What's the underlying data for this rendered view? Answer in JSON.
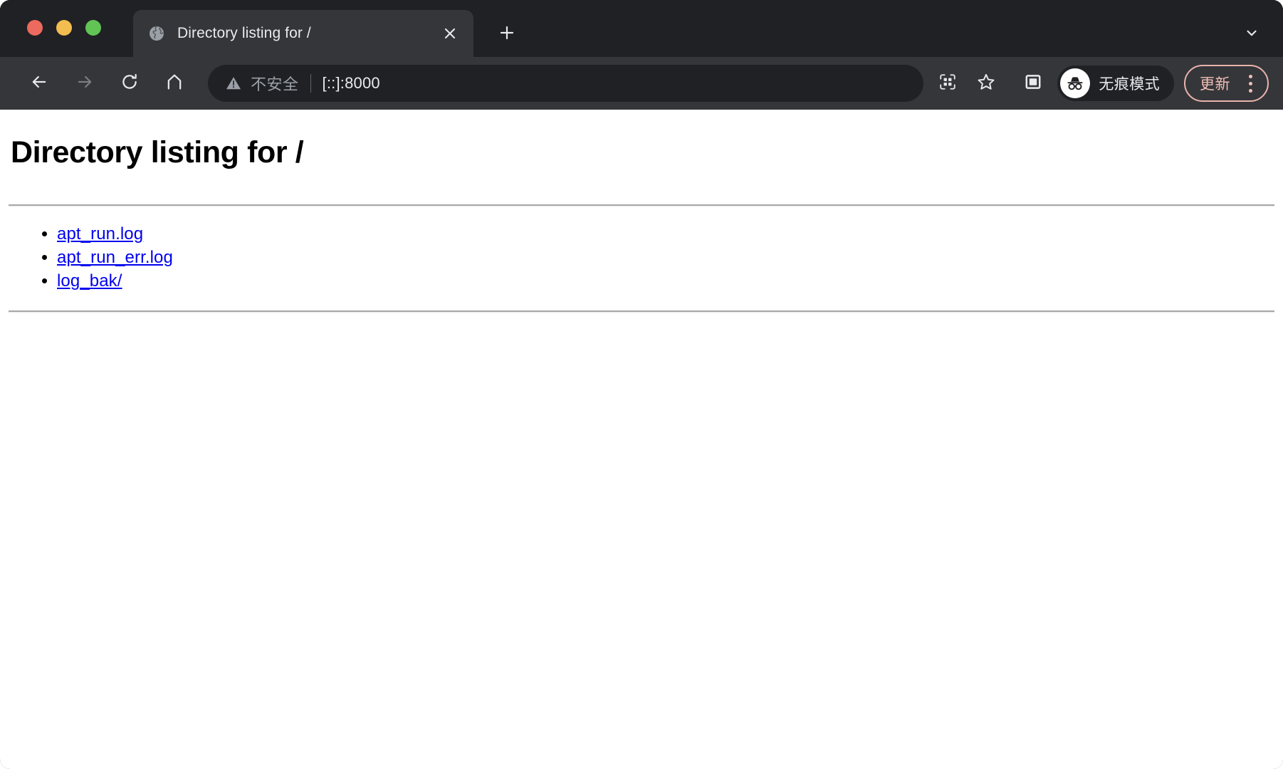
{
  "window": {
    "controls": {
      "close_label": "close",
      "minimize_label": "minimize",
      "maximize_label": "maximize"
    }
  },
  "tab_strip": {
    "tabs": [
      {
        "title": "Directory listing for /",
        "favicon": "globe-icon",
        "close_icon": "close-icon",
        "active": true
      }
    ],
    "new_tab_icon": "plus-icon",
    "tab_search_icon": "chevron-down-icon"
  },
  "toolbar": {
    "back_icon": "arrow-left-icon",
    "forward_icon": "arrow-right-icon",
    "reload_icon": "reload-icon",
    "home_icon": "home-icon",
    "omnibox": {
      "security_icon": "warning-triangle-icon",
      "security_text": "不安全",
      "url": "[::]:8000"
    },
    "qr_icon": "qr-code-icon",
    "bookmark_icon": "star-icon",
    "side_panel_icon": "side-panel-icon",
    "profile": {
      "avatar_icon": "incognito-icon",
      "label": "无痕模式"
    },
    "update": {
      "label": "更新",
      "menu_icon": "three-dot-menu-icon",
      "accent_color": "#f0c0b6",
      "border_color": "#e8b4ab"
    }
  },
  "page": {
    "title": "Directory listing for /",
    "entries": [
      {
        "name": "apt_run.log",
        "type": "file"
      },
      {
        "name": "apt_run_err.log",
        "type": "file"
      },
      {
        "name": "log_bak/",
        "type": "directory"
      }
    ],
    "link_color": "#0000ee",
    "background_color": "#ffffff"
  }
}
